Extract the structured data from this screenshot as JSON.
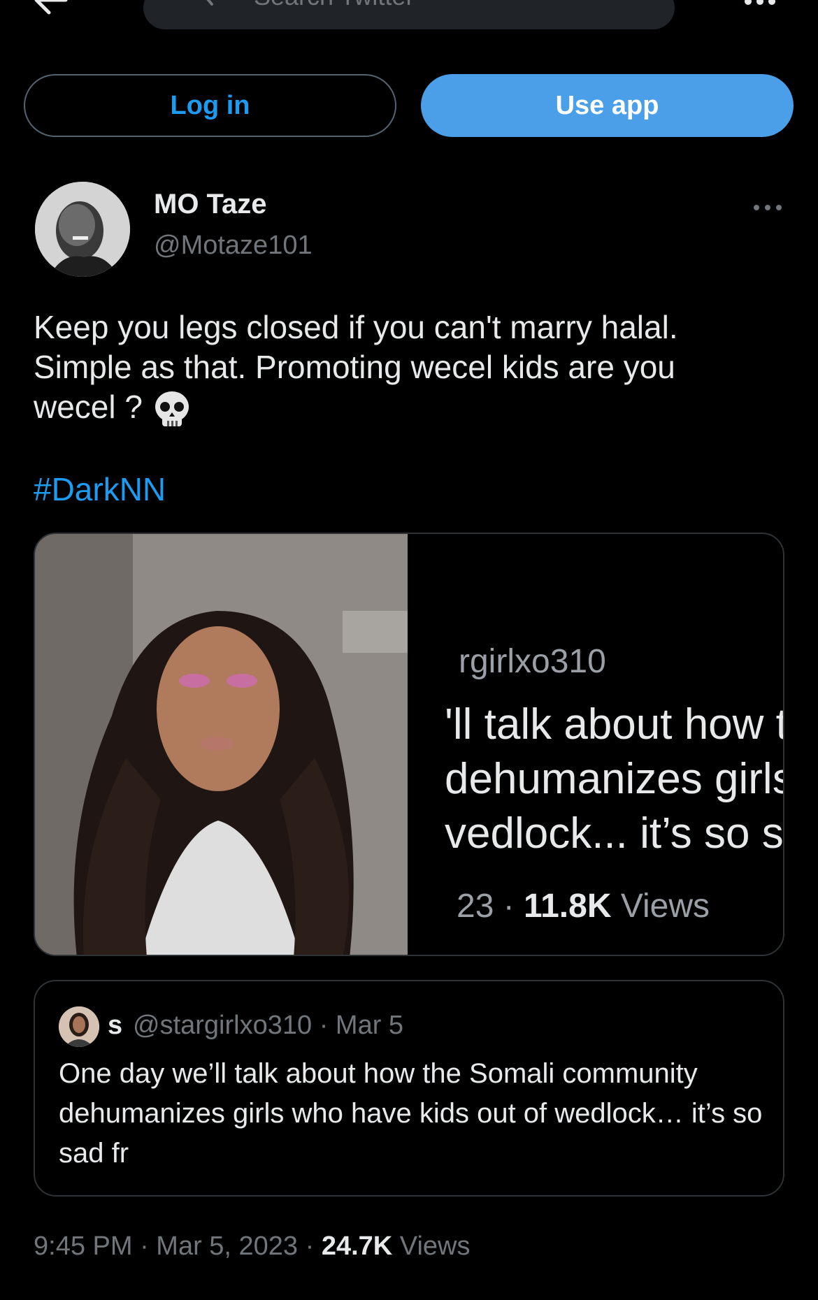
{
  "header": {
    "search_placeholder": "Search Twitter"
  },
  "auth": {
    "login_label": "Log in",
    "use_app_label": "Use app"
  },
  "post": {
    "display_name": "MO Taze",
    "handle": "@Motaze101",
    "text": "Keep you legs closed if you can't marry halal.\nSimple as that. Promoting wecel kids are you\nwecel ?",
    "emoji": "skull-emoji",
    "hashtag": "#DarkNN",
    "media": {
      "handle_fragment": "rgirlxo310",
      "line1": "'ll talk about how th",
      "line2": "dehumanizes girls v",
      "line3": "vedlock... it’s so sac",
      "stats_prefix": "23 · ",
      "views_count": "11.8K",
      "views_label": " Views"
    },
    "quote": {
      "name": "s",
      "handle": "@stargirlxo310",
      "separator": " · ",
      "date": "Mar 5",
      "text": "One day we’ll talk about how the Somali community dehumanizes girls who have kids out of wedlock… it’s so sad fr"
    },
    "time": "9:45 PM · Mar 5, 2023 · ",
    "views_count": "24.7K",
    "views_label": " Views"
  },
  "colors": {
    "background": "#000000",
    "link": "#1d9bf0",
    "use_app_button": "#4a9fe8",
    "secondary_text": "#71767b",
    "border": "#2f3336"
  },
  "icons": [
    "back-arrow-icon",
    "search-icon",
    "more-icon",
    "skull-emoji"
  ]
}
